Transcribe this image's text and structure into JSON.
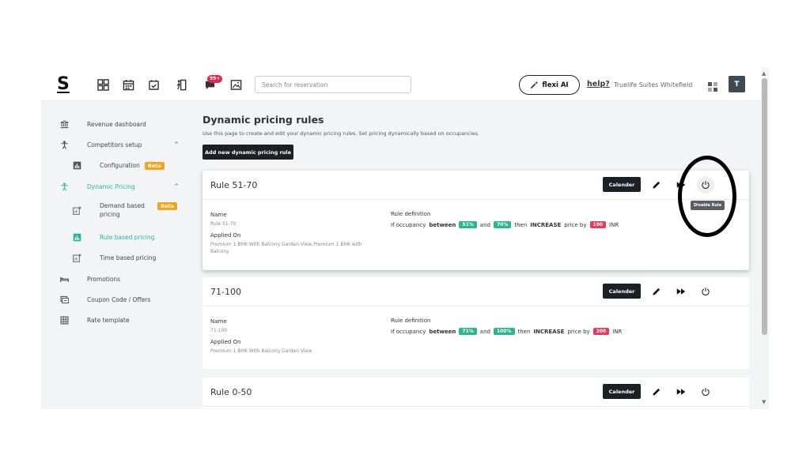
{
  "topbar": {
    "logo": "S",
    "notif_badge": "99+",
    "search_placeholder": "Search for reservation",
    "flexi_label": "flexi AI",
    "help_label": "help?",
    "hotel_name": "Truelife Suites Whitefield",
    "avatar_initial": "T"
  },
  "sidebar": {
    "revenue_dashboard": "Revenue dashboard",
    "competitors_setup": "Competitors setup",
    "configuration": "Configuration",
    "beta": "Beta",
    "dynamic_pricing": "Dynamic Pricing",
    "demand_based_pricing": "Demand based pricing",
    "rule_based_pricing": "Rule based pricing",
    "time_based_pricing": "Time based pricing",
    "promotions": "Promotions",
    "coupon_code": "Coupon Code / Offers",
    "rate_template": "Rate template"
  },
  "main": {
    "title": "Dynamic pricing rules",
    "subtitle": "Use this page to create and edit your dynamic pricing rules. Set pricing dynamically based on occupancies.",
    "add_button": "Add new dynamic pricing rule",
    "tooltip": "Disable Rule",
    "labels": {
      "name": "Name",
      "applied_on": "Applied On",
      "rule_definition": "Rule definition",
      "if_occupancy": "If occupancy",
      "between": "between",
      "and": "and",
      "then": "then",
      "increase": "INCREASE",
      "price_by": "price by",
      "calender": "Calender"
    },
    "rules": [
      {
        "title": "Rule 51-70",
        "name": "Rule 51-70",
        "applied_on": "Premium 1 BHK With Balcony Garden View,Premium 1 BHK with Balcony",
        "from": "51%",
        "to": "70%",
        "amount": "100",
        "currency": "INR"
      },
      {
        "title": "71-100",
        "name": "71-100",
        "applied_on": "Premium 1 BHK With Balcony Garden View",
        "from": "71%",
        "to": "100%",
        "amount": "200",
        "currency": "INR"
      },
      {
        "title": "Rule 0-50"
      }
    ]
  },
  "colors": {
    "accent": "#21b8a0",
    "beta": "#f7a21b",
    "pill_green": "#2ab790",
    "pill_red": "#ea3a55",
    "button_dark": "#1c2126"
  }
}
